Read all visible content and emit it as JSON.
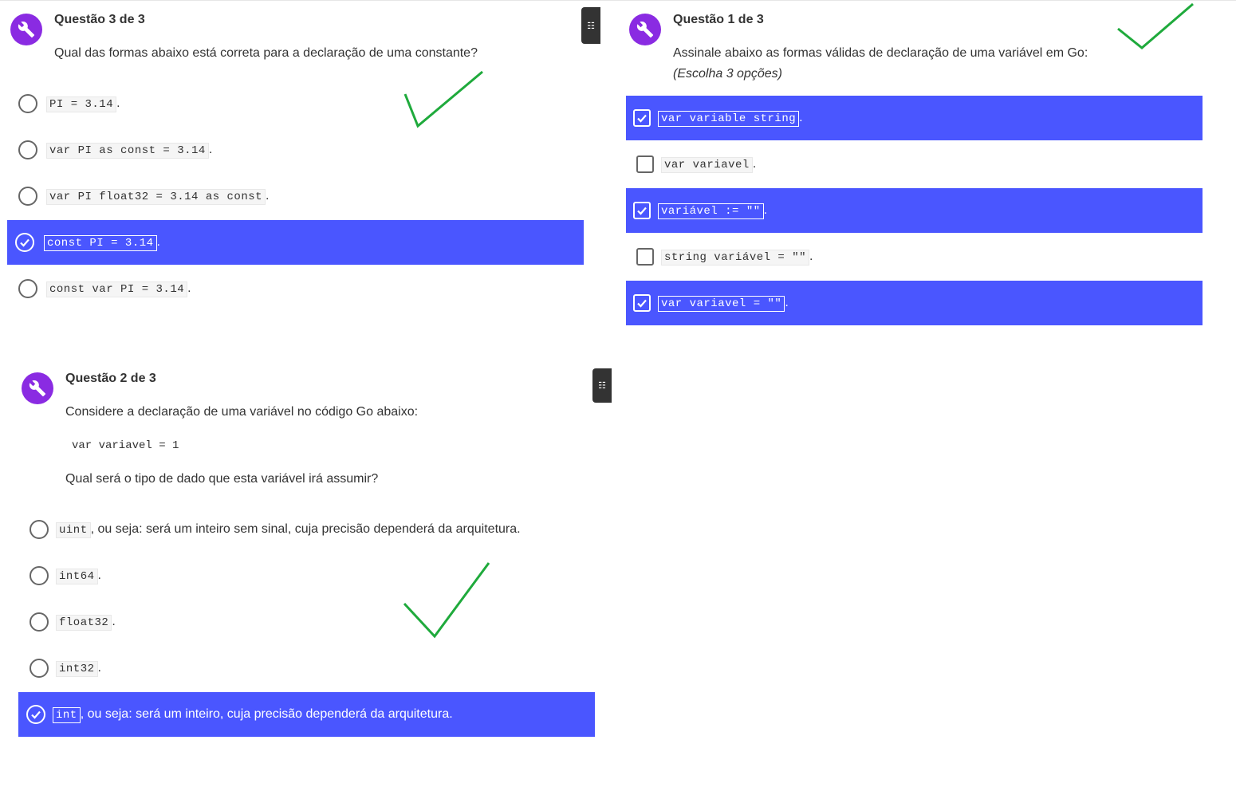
{
  "colors": {
    "accent": "#4a56ff",
    "icon_bg": "#8a2be2",
    "checkmark": "#1faa3c"
  },
  "q3": {
    "title": "Questão 3 de 3",
    "prompt": "Qual das formas abaixo está correta para a declaração de uma constante?",
    "options": [
      {
        "code": "PI = 3.14",
        "after": ".",
        "selected": false
      },
      {
        "code": "var PI as const = 3.14",
        "after": ".",
        "selected": false
      },
      {
        "code": "var PI float32 = 3.14 as const",
        "after": ".",
        "selected": false
      },
      {
        "code": "const PI = 3.14",
        "after": ".",
        "selected": true
      },
      {
        "code": "const var PI = 3.14",
        "after": ".",
        "selected": false
      }
    ]
  },
  "q1": {
    "title": "Questão 1 de 3",
    "prompt": "Assinale abaixo as formas válidas de declaração de uma variável em Go:",
    "hint": "(Escolha 3 opções)",
    "options": [
      {
        "code": "var variable string",
        "after": ".",
        "selected": true
      },
      {
        "code": "var variavel",
        "after": ".",
        "selected": false
      },
      {
        "code": "variável := \"\"",
        "after": ".",
        "selected": true
      },
      {
        "code": "string variável = \"\"",
        "after": ".",
        "selected": false
      },
      {
        "code": "var variavel = \"\"",
        "after": ".",
        "selected": true
      }
    ]
  },
  "q2": {
    "title": "Questão 2 de 3",
    "prompt": "Considere a declaração de uma variável no código Go abaixo:",
    "code": "var variavel = 1",
    "question": "Qual será o tipo de dado que esta variável irá assumir?",
    "options": [
      {
        "code": "uint",
        "after": ", ou seja: será um inteiro sem sinal, cuja precisão dependerá da arquitetura.",
        "selected": false
      },
      {
        "code": "int64",
        "after": ".",
        "selected": false
      },
      {
        "code": "float32",
        "after": ".",
        "selected": false
      },
      {
        "code": "int32",
        "after": ".",
        "selected": false
      },
      {
        "code": "int",
        "after": ", ou seja: será um inteiro, cuja precisão dependerá da arquitetura.",
        "selected": true
      }
    ]
  },
  "icons": {
    "question": "wrench-icon",
    "sidebar": "list-icon",
    "annotation": "green-checkmark"
  }
}
